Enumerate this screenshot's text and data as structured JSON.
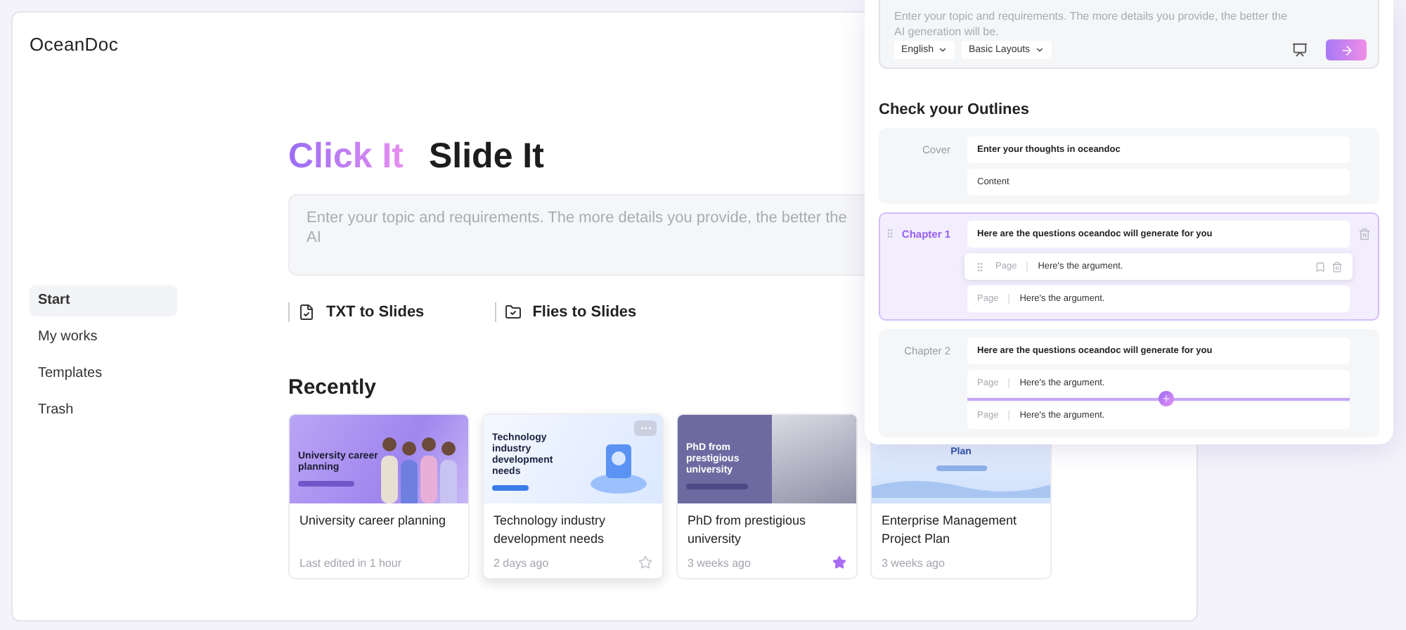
{
  "app": {
    "logo": "OceanDoc"
  },
  "sidebar": {
    "items": [
      {
        "label": "Start",
        "selected": true
      },
      {
        "label": "My works",
        "selected": false
      },
      {
        "label": "Templates",
        "selected": false
      },
      {
        "label": "Trash",
        "selected": false
      }
    ]
  },
  "hero": {
    "title_accent": "Click It",
    "title": "Slide It",
    "input": {
      "placeholder": "Enter your topic and requirements. The more details you provide, the better the AI"
    }
  },
  "actions": [
    {
      "kind": "file",
      "label": "TXT to Slides"
    },
    {
      "kind": "folder",
      "label": "Flies to Slides"
    }
  ],
  "recent": {
    "title": "Recently",
    "cards": [
      {
        "title": "University career planning",
        "meta": "Last edited in 1 hour",
        "starred": false,
        "hovered": false,
        "thumbnail": {
          "title": "University career planning"
        }
      },
      {
        "title": "Technology industry development needs",
        "meta": "2 days ago",
        "starred": false,
        "hovered": true,
        "thumbnail": {
          "title": "Technology industry development needs"
        }
      },
      {
        "title": "PhD from prestigious university",
        "meta": "3 weeks ago",
        "starred": true,
        "hovered": false,
        "thumbnail": {
          "title": "PhD from prestigious university"
        }
      },
      {
        "title": "Enterprise Management Project Plan",
        "meta": "3 weeks ago",
        "starred": false,
        "hovered": false,
        "thumbnail": {
          "title": "Plan"
        }
      }
    ]
  },
  "panel": {
    "prompt": {
      "placeholder": "Enter your topic and requirements. The more details you provide, the better the AI generation will be."
    },
    "dropdowns": [
      {
        "value": "English"
      },
      {
        "value": "Basic Layouts"
      }
    ],
    "outline_title": "Check your Outlines",
    "sections": [
      {
        "label": "Cover",
        "selected": false,
        "title": "Enter your thoughts in oceandoc",
        "pages": [
          {
            "text": "Content",
            "hovered": false,
            "insert_below": false
          }
        ]
      },
      {
        "label": "Chapter 1",
        "selected": true,
        "title": "Here are the questions oceandoc will generate for you",
        "pages": [
          {
            "label": "Page",
            "text": "Here's the argument.",
            "hovered": true,
            "insert_below": false
          },
          {
            "label": "Page",
            "text": "Here's the argument.",
            "hovered": false,
            "insert_below": false
          }
        ]
      },
      {
        "label": "Chapter 2",
        "selected": false,
        "title": "Here are the questions oceandoc will generate for you",
        "pages": [
          {
            "label": "Page",
            "text": "Here's the argument.",
            "hovered": false,
            "insert_below": true
          },
          {
            "label": "Page",
            "text": "Here's the argument.",
            "hovered": false,
            "insert_below": false
          }
        ]
      }
    ]
  }
}
